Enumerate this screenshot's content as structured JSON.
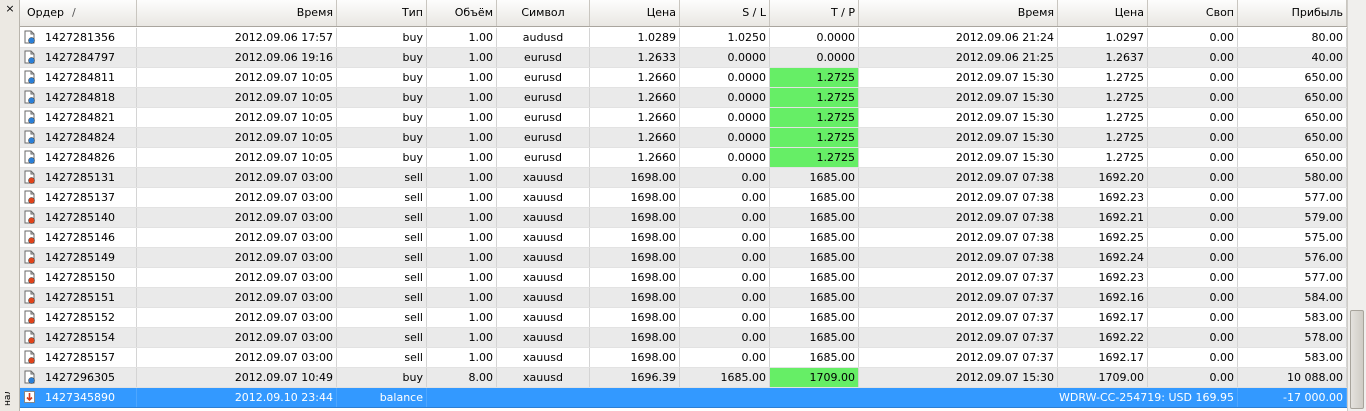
{
  "panel": {
    "close_glyph": "×",
    "side_label": "нал"
  },
  "columns": [
    "Ордер",
    "Время",
    "Тип",
    "Объём",
    "Символ",
    "Цена",
    "S / L",
    "T / P",
    "Время",
    "Цена",
    "Своп",
    "Прибыль"
  ],
  "sort_indicator": "/",
  "icon_colors": {
    "buy": "#2b7fd6",
    "sell": "#e0441c",
    "balance": "#d23a1a"
  },
  "highlight_color": "#66ee66",
  "rows": [
    {
      "order": "1427281356",
      "open_time": "2012.09.06 17:57",
      "type": "buy",
      "volume": "1.00",
      "symbol": "audusd",
      "open_price": "1.0289",
      "sl": "1.0250",
      "tp": "0.0000",
      "tp_hit": false,
      "close_time": "2012.09.06 21:24",
      "close_price": "1.0297",
      "swap": "0.00",
      "profit": "80.00",
      "kind": "buy"
    },
    {
      "order": "1427284797",
      "open_time": "2012.09.06 19:16",
      "type": "buy",
      "volume": "1.00",
      "symbol": "eurusd",
      "open_price": "1.2633",
      "sl": "0.0000",
      "tp": "0.0000",
      "tp_hit": false,
      "close_time": "2012.09.06 21:25",
      "close_price": "1.2637",
      "swap": "0.00",
      "profit": "40.00",
      "kind": "buy"
    },
    {
      "order": "1427284811",
      "open_time": "2012.09.07 10:05",
      "type": "buy",
      "volume": "1.00",
      "symbol": "eurusd",
      "open_price": "1.2660",
      "sl": "0.0000",
      "tp": "1.2725",
      "tp_hit": true,
      "close_time": "2012.09.07 15:30",
      "close_price": "1.2725",
      "swap": "0.00",
      "profit": "650.00",
      "kind": "buy"
    },
    {
      "order": "1427284818",
      "open_time": "2012.09.07 10:05",
      "type": "buy",
      "volume": "1.00",
      "symbol": "eurusd",
      "open_price": "1.2660",
      "sl": "0.0000",
      "tp": "1.2725",
      "tp_hit": true,
      "close_time": "2012.09.07 15:30",
      "close_price": "1.2725",
      "swap": "0.00",
      "profit": "650.00",
      "kind": "buy"
    },
    {
      "order": "1427284821",
      "open_time": "2012.09.07 10:05",
      "type": "buy",
      "volume": "1.00",
      "symbol": "eurusd",
      "open_price": "1.2660",
      "sl": "0.0000",
      "tp": "1.2725",
      "tp_hit": true,
      "close_time": "2012.09.07 15:30",
      "close_price": "1.2725",
      "swap": "0.00",
      "profit": "650.00",
      "kind": "buy"
    },
    {
      "order": "1427284824",
      "open_time": "2012.09.07 10:05",
      "type": "buy",
      "volume": "1.00",
      "symbol": "eurusd",
      "open_price": "1.2660",
      "sl": "0.0000",
      "tp": "1.2725",
      "tp_hit": true,
      "close_time": "2012.09.07 15:30",
      "close_price": "1.2725",
      "swap": "0.00",
      "profit": "650.00",
      "kind": "buy"
    },
    {
      "order": "1427284826",
      "open_time": "2012.09.07 10:05",
      "type": "buy",
      "volume": "1.00",
      "symbol": "eurusd",
      "open_price": "1.2660",
      "sl": "0.0000",
      "tp": "1.2725",
      "tp_hit": true,
      "close_time": "2012.09.07 15:30",
      "close_price": "1.2725",
      "swap": "0.00",
      "profit": "650.00",
      "kind": "buy"
    },
    {
      "order": "1427285131",
      "open_time": "2012.09.07 03:00",
      "type": "sell",
      "volume": "1.00",
      "symbol": "xauusd",
      "open_price": "1698.00",
      "sl": "0.00",
      "tp": "1685.00",
      "tp_hit": false,
      "close_time": "2012.09.07 07:38",
      "close_price": "1692.20",
      "swap": "0.00",
      "profit": "580.00",
      "kind": "sell"
    },
    {
      "order": "1427285137",
      "open_time": "2012.09.07 03:00",
      "type": "sell",
      "volume": "1.00",
      "symbol": "xauusd",
      "open_price": "1698.00",
      "sl": "0.00",
      "tp": "1685.00",
      "tp_hit": false,
      "close_time": "2012.09.07 07:38",
      "close_price": "1692.23",
      "swap": "0.00",
      "profit": "577.00",
      "kind": "sell"
    },
    {
      "order": "1427285140",
      "open_time": "2012.09.07 03:00",
      "type": "sell",
      "volume": "1.00",
      "symbol": "xauusd",
      "open_price": "1698.00",
      "sl": "0.00",
      "tp": "1685.00",
      "tp_hit": false,
      "close_time": "2012.09.07 07:38",
      "close_price": "1692.21",
      "swap": "0.00",
      "profit": "579.00",
      "kind": "sell"
    },
    {
      "order": "1427285146",
      "open_time": "2012.09.07 03:00",
      "type": "sell",
      "volume": "1.00",
      "symbol": "xauusd",
      "open_price": "1698.00",
      "sl": "0.00",
      "tp": "1685.00",
      "tp_hit": false,
      "close_time": "2012.09.07 07:38",
      "close_price": "1692.25",
      "swap": "0.00",
      "profit": "575.00",
      "kind": "sell"
    },
    {
      "order": "1427285149",
      "open_time": "2012.09.07 03:00",
      "type": "sell",
      "volume": "1.00",
      "symbol": "xauusd",
      "open_price": "1698.00",
      "sl": "0.00",
      "tp": "1685.00",
      "tp_hit": false,
      "close_time": "2012.09.07 07:38",
      "close_price": "1692.24",
      "swap": "0.00",
      "profit": "576.00",
      "kind": "sell"
    },
    {
      "order": "1427285150",
      "open_time": "2012.09.07 03:00",
      "type": "sell",
      "volume": "1.00",
      "symbol": "xauusd",
      "open_price": "1698.00",
      "sl": "0.00",
      "tp": "1685.00",
      "tp_hit": false,
      "close_time": "2012.09.07 07:37",
      "close_price": "1692.23",
      "swap": "0.00",
      "profit": "577.00",
      "kind": "sell"
    },
    {
      "order": "1427285151",
      "open_time": "2012.09.07 03:00",
      "type": "sell",
      "volume": "1.00",
      "symbol": "xauusd",
      "open_price": "1698.00",
      "sl": "0.00",
      "tp": "1685.00",
      "tp_hit": false,
      "close_time": "2012.09.07 07:37",
      "close_price": "1692.16",
      "swap": "0.00",
      "profit": "584.00",
      "kind": "sell"
    },
    {
      "order": "1427285152",
      "open_time": "2012.09.07 03:00",
      "type": "sell",
      "volume": "1.00",
      "symbol": "xauusd",
      "open_price": "1698.00",
      "sl": "0.00",
      "tp": "1685.00",
      "tp_hit": false,
      "close_time": "2012.09.07 07:37",
      "close_price": "1692.17",
      "swap": "0.00",
      "profit": "583.00",
      "kind": "sell"
    },
    {
      "order": "1427285154",
      "open_time": "2012.09.07 03:00",
      "type": "sell",
      "volume": "1.00",
      "symbol": "xauusd",
      "open_price": "1698.00",
      "sl": "0.00",
      "tp": "1685.00",
      "tp_hit": false,
      "close_time": "2012.09.07 07:37",
      "close_price": "1692.22",
      "swap": "0.00",
      "profit": "578.00",
      "kind": "sell"
    },
    {
      "order": "1427285157",
      "open_time": "2012.09.07 03:00",
      "type": "sell",
      "volume": "1.00",
      "symbol": "xauusd",
      "open_price": "1698.00",
      "sl": "0.00",
      "tp": "1685.00",
      "tp_hit": false,
      "close_time": "2012.09.07 07:37",
      "close_price": "1692.17",
      "swap": "0.00",
      "profit": "583.00",
      "kind": "sell"
    },
    {
      "order": "1427296305",
      "open_time": "2012.09.07 10:49",
      "type": "buy",
      "volume": "8.00",
      "symbol": "xauusd",
      "open_price": "1696.39",
      "sl": "1685.00",
      "tp": "1709.00",
      "tp_hit": true,
      "close_time": "2012.09.07 15:30",
      "close_price": "1709.00",
      "swap": "0.00",
      "profit": "10 088.00",
      "kind": "buy"
    }
  ],
  "balance_row": {
    "order": "1427345890",
    "time": "2012.09.10 23:44",
    "type": "balance",
    "comment": "WDRW-CC-254719: USD 169.95",
    "profit": "-17 000.00"
  }
}
